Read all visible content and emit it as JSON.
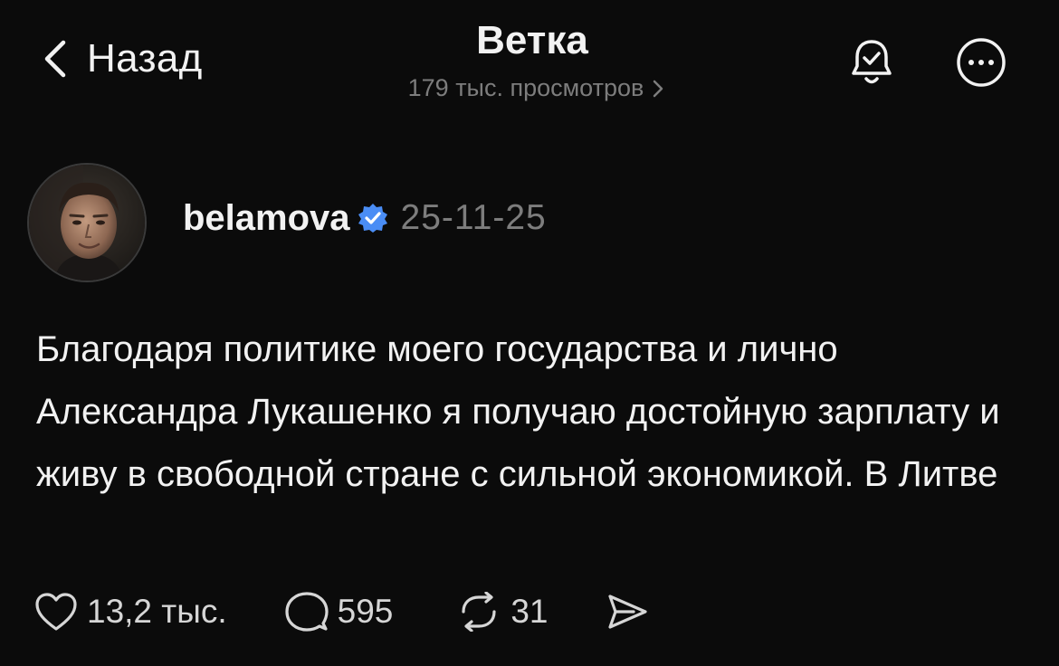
{
  "header": {
    "back_label": "Назад",
    "title": "Ветка",
    "views": "179 тыс. просмотров"
  },
  "post": {
    "username": "belamova",
    "date": "25-11-25",
    "text": "Благодаря политике моего государства и лично Александра Лукашенко я получаю достойную зарплату и живу в свободной стране с сильной экономикой. В Литве",
    "likes": "13,2 тыс.",
    "replies": "595",
    "reposts": "31"
  },
  "icons": {
    "back": "chevron-left-icon",
    "views_arrow": "chevron-right-icon",
    "notify": "bell-check-icon",
    "more": "more-circle-icon",
    "verified": "verified-badge-icon",
    "like": "heart-icon",
    "reply": "comment-icon",
    "repost": "repost-icon",
    "share": "send-icon"
  },
  "colors": {
    "background": "#0b0b0b",
    "text": "#f2f2f2",
    "secondary": "#7d7d7d",
    "verified": "#4a8df5"
  }
}
